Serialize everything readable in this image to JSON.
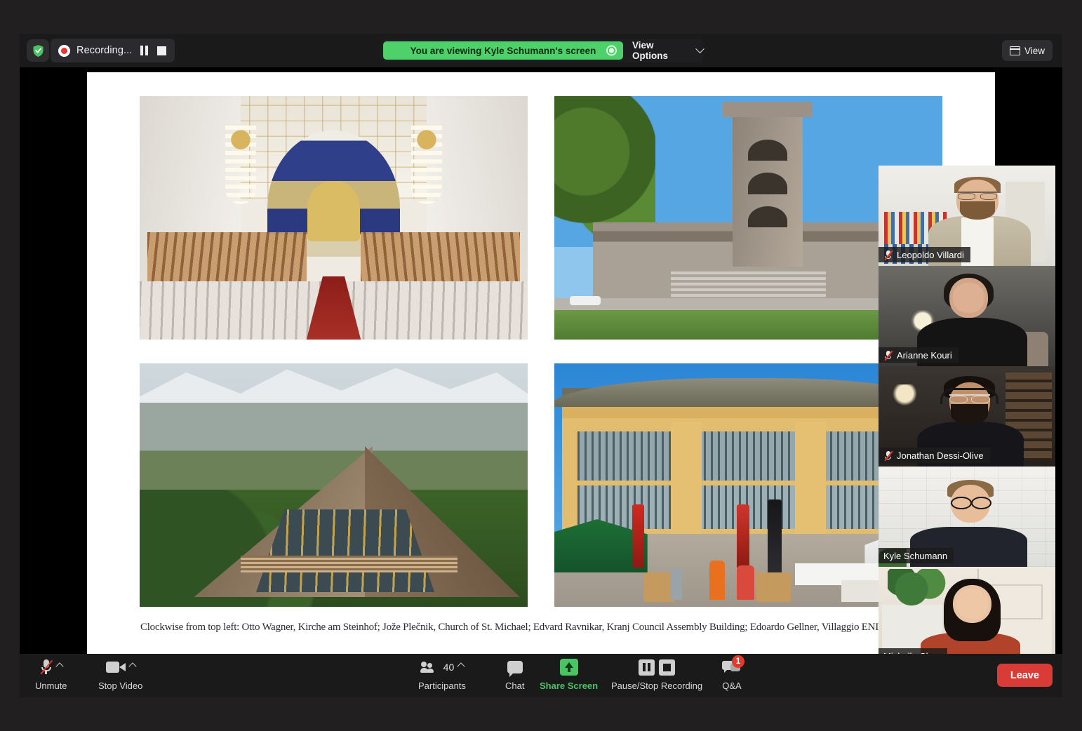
{
  "topbar": {
    "encryption_icon": "shield-check-icon",
    "recording_label": "Recording...",
    "recording_dot_icon": "record-dot-icon",
    "pause_recording_icon": "pause-icon",
    "stop_recording_icon": "stop-icon",
    "sharing_banner_text": "You are viewing Kyle Schumann's screen",
    "sharing_indicator_icon": "screen-share-indicator-icon",
    "view_options_label": "View Options",
    "view_options_chevron_icon": "chevron-down-icon",
    "view_button_label": "View",
    "view_button_icon": "grid-view-icon",
    "accent_green": "#4ed06a",
    "banner_text_color": "#0d2a13"
  },
  "shared_screen": {
    "slide_caption": "Clockwise from top left: Otto Wagner, Kirche am Steinhof; Jože Plečnik, Church of St. Michael; Edvard Ravnikar, Kranj Council Assembly Building; Edoardo Gellner, Villaggio ENI Colonia",
    "photos": [
      {
        "position": "top-left",
        "subject": "Otto Wagner, Kirche am Steinhof — church interior with chandeliers and red aisle carpet"
      },
      {
        "position": "top-right",
        "subject": "Jože Plečnik, Church of St. Michael — stone bell tower under blue sky"
      },
      {
        "position": "bottom-left",
        "subject": "Edoardo Gellner, Villaggio ENI Colonia — A-frame chapel in the mountains"
      },
      {
        "position": "bottom-right",
        "subject": "Edvard Ravnikar, Kranj Council Assembly Building — yellow modernist building with a street event"
      }
    ]
  },
  "participants": [
    {
      "name": "Leopoldo Villardi",
      "muted": true,
      "active_speaker": false,
      "mute_icon": "muted-mic-icon"
    },
    {
      "name": "Arianne Kouri",
      "muted": true,
      "active_speaker": false,
      "mute_icon": "muted-mic-icon"
    },
    {
      "name": "Jonathan Dessi-Olive",
      "muted": true,
      "active_speaker": false,
      "mute_icon": "muted-mic-icon"
    },
    {
      "name": "Kyle Schumann",
      "muted": false,
      "active_speaker": true,
      "mute_icon": ""
    },
    {
      "name": "Michelle Chen",
      "muted": false,
      "active_speaker": false,
      "mute_icon": ""
    }
  ],
  "active_speaker_border_color": "#cddc2a",
  "toolbar": {
    "mute": {
      "label": "Unmute",
      "icon": "muted-mic-icon",
      "has_caret": true
    },
    "video": {
      "label": "Stop Video",
      "icon": "camera-icon",
      "has_caret": true
    },
    "participants": {
      "label": "Participants",
      "icon": "people-icon",
      "count": "40",
      "has_caret": true
    },
    "chat": {
      "label": "Chat",
      "icon": "chat-bubble-icon"
    },
    "share_screen": {
      "label": "Share Screen",
      "icon": "share-screen-icon",
      "color": "#4ac362"
    },
    "recording": {
      "label": "Pause/Stop Recording",
      "pause_icon": "pause-icon",
      "stop_icon": "stop-icon"
    },
    "qa": {
      "label": "Q&A",
      "icon": "qa-bubbles-icon",
      "badge": "1",
      "badge_color": "#e23b2e"
    },
    "leave": {
      "label": "Leave",
      "color": "#d93b36"
    }
  }
}
